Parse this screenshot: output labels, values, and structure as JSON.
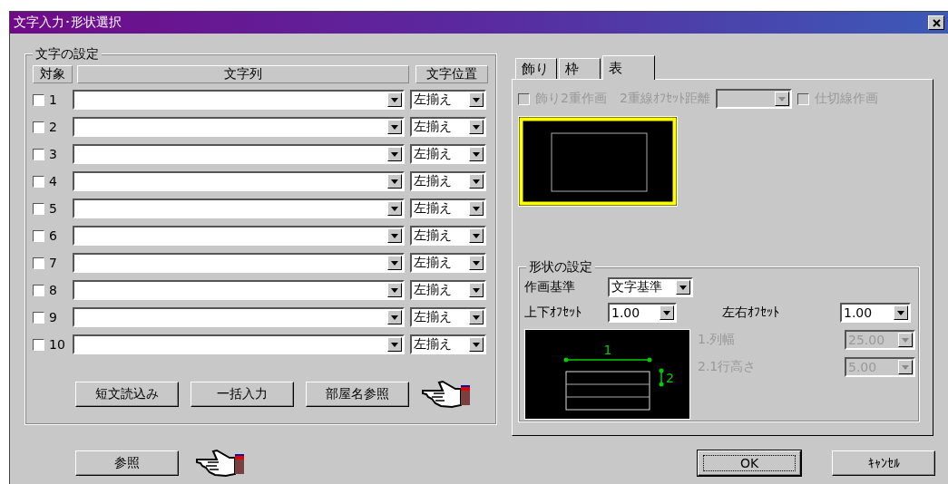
{
  "window": {
    "title": "文字入力･形状選択"
  },
  "text_settings": {
    "title": "文字の設定",
    "columns": [
      "対象",
      "文字列",
      "文字位置"
    ],
    "rows": [
      {
        "number": "1",
        "checked": false,
        "position": "左揃え"
      },
      {
        "number": "2",
        "checked": false,
        "position": "左揃え"
      },
      {
        "number": "3",
        "checked": false,
        "position": "左揃え"
      },
      {
        "number": "4",
        "checked": false,
        "position": "左揃え"
      },
      {
        "number": "5",
        "checked": false,
        "position": "左揃え"
      },
      {
        "number": "6",
        "checked": false,
        "position": "左揃え"
      },
      {
        "number": "7",
        "checked": false,
        "position": "左揃え"
      },
      {
        "number": "8",
        "checked": false,
        "position": "左揃え"
      },
      {
        "number": "9",
        "checked": false,
        "position": "左揃え"
      },
      {
        "number": "10",
        "checked": false,
        "position": "左揃え"
      }
    ],
    "buttons": [
      "短文読込み",
      "一括入力",
      "部屋名参照"
    ]
  },
  "tabs": [
    {
      "label": "飾り",
      "selected": false
    },
    {
      "label": "枠",
      "selected": false
    },
    {
      "label": "表",
      "selected": true
    }
  ],
  "options": {
    "double_decoration": {
      "label": "飾り2重作画",
      "checked": false,
      "disabled": true
    },
    "offset_distance": {
      "label": "2重線ｵﾌｾｯﾄ距離",
      "disabled": true
    },
    "divider_lines": {
      "label": "仕切線作画",
      "checked": false,
      "disabled": true
    }
  },
  "shape_settings": {
    "title": "形状の設定",
    "drawing_basis": {
      "label": "作画基準",
      "value": "文字基準"
    },
    "vertical_offset": {
      "label": "上下ｵﾌｾｯﾄ",
      "value": "1.00"
    },
    "horizontal_offset": {
      "label": "左右ｵﾌｾｯﾄ",
      "value": "1.00"
    },
    "column_width": {
      "label": "1.列幅",
      "value": "25.00",
      "disabled": true
    },
    "row_height": {
      "label": "2.1行高さ",
      "value": "5.00",
      "disabled": true
    },
    "diagram_labels": [
      "1",
      "2"
    ]
  },
  "footer": {
    "browse": "参照",
    "ok": "OK",
    "cancel": "ｷｬﾝｾﾙ"
  }
}
